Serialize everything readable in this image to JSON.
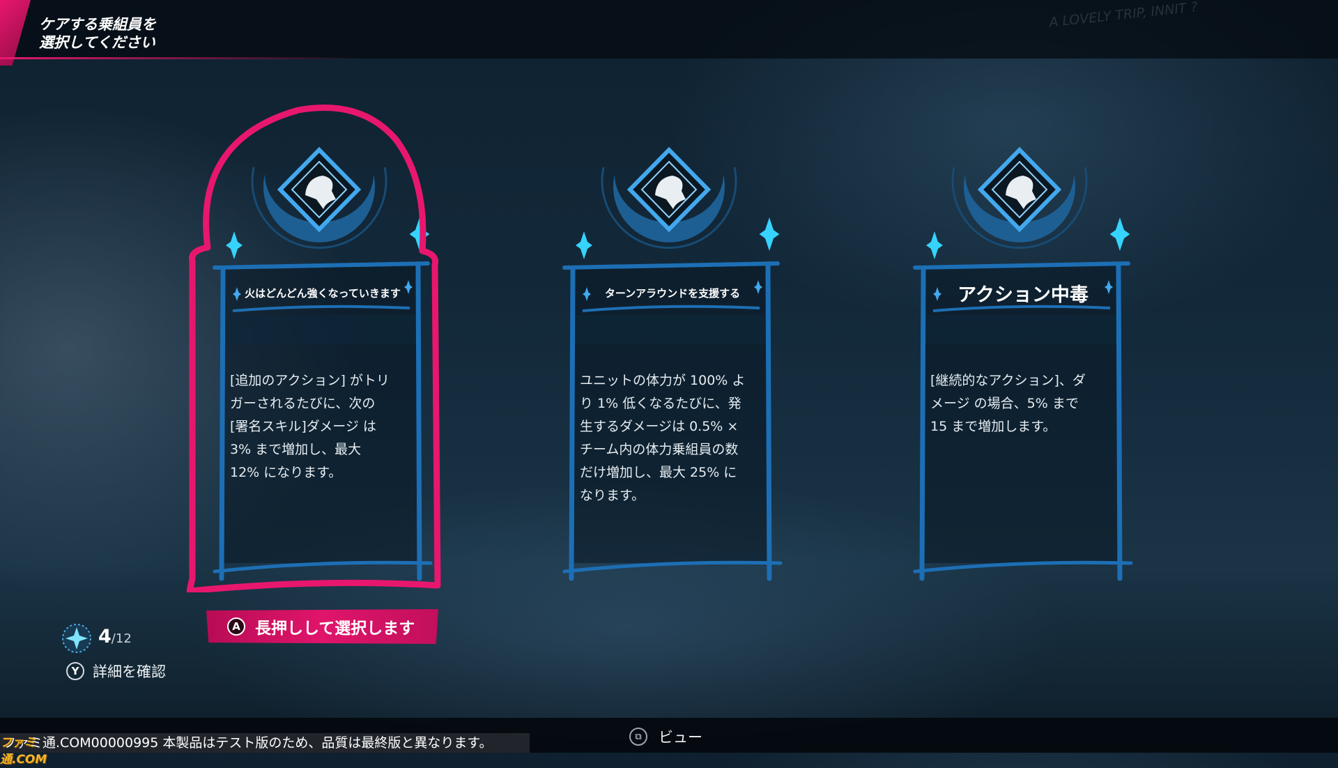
{
  "header": {
    "title": "ケアする乗組員を\n選択してください",
    "scribble": "A LOVELY TRIP, INNIT ?"
  },
  "cards": [
    {
      "title": "火はどんどん強くなっていきます",
      "description": "[追加のアクション] がトリ\nガーされるたびに、次の\n[署名スキル]ダメージ は\n3% まで増加し、最大\n12% になります。",
      "selected": true
    },
    {
      "title": "ターンアラウンドを支援する",
      "description": "ユニットの体力が 100% よ\nり 1% 低くなるたびに、発\n生するダメージは 0.5% ×\nチーム内の体力乗組員の数\nだけ増加し、最大 25% に\nなります。",
      "selected": false
    },
    {
      "title": "アクション中毒",
      "description": "[継続的なアクション]、ダ\nメージ の場合、5% まで\n15 まで増加します。",
      "selected": false
    }
  ],
  "counter": {
    "current": "4",
    "total": "/12",
    "icon": "star-badge-icon"
  },
  "hints": {
    "select_button": "A",
    "select_label": "長押しして選択します",
    "detail_button": "Y",
    "detail_label": "詳細を確認",
    "view_icon": "⧉",
    "view_label": "ビュー"
  },
  "footer": {
    "disclaimer": "ファミ通.COM00000995  本製品はテスト版のため、品質は最終版と異なります。",
    "watermark": "ファミ通.COM"
  },
  "colors": {
    "accent_pink": "#e8176e",
    "frame_blue": "#1d6fb5",
    "badge_blue": "#43a8ee",
    "sparkle_cyan": "#36d3ff"
  }
}
